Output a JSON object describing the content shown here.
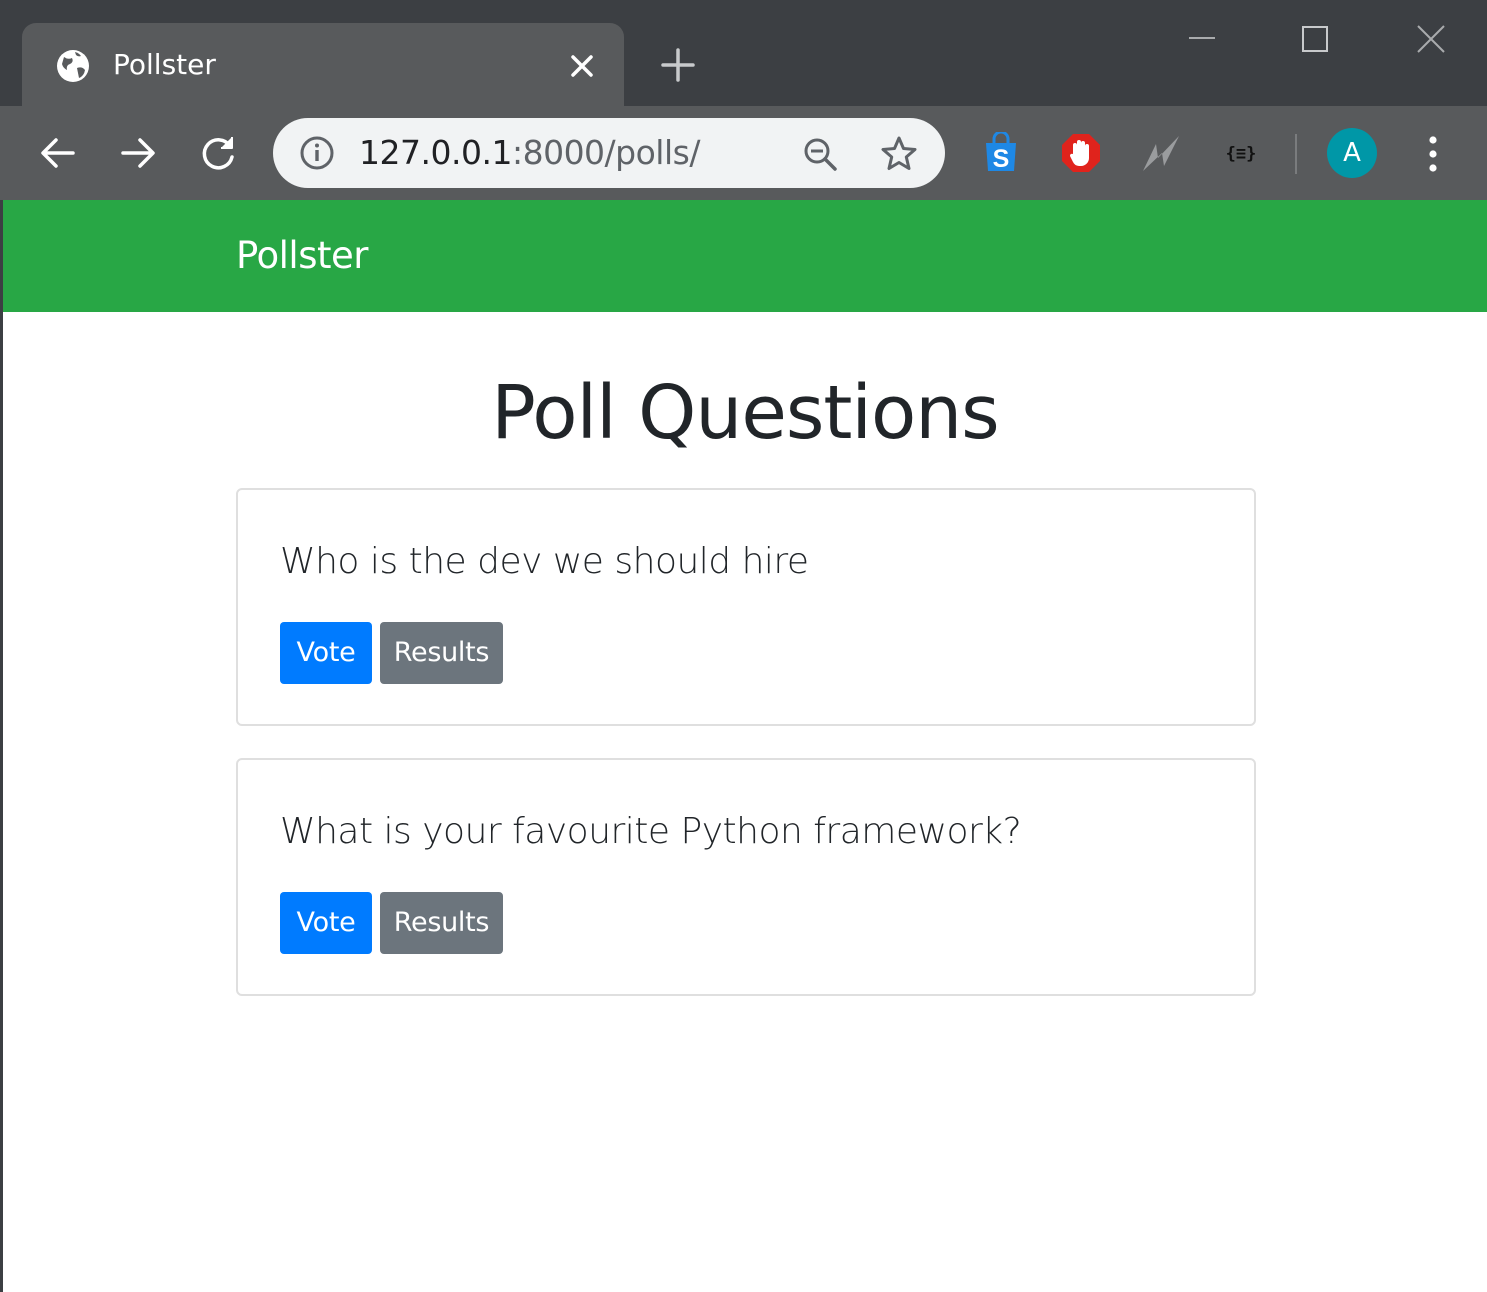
{
  "browser": {
    "tab": {
      "title": "Pollster",
      "favicon": "globe-icon"
    },
    "url": {
      "host": "127.0.0.1",
      "rest": ":8000/polls/"
    },
    "avatar_letter": "A",
    "extensions": [
      "shopping-s-icon",
      "adblock-hand-icon",
      "lightning-icon",
      "json-formatter-icon"
    ],
    "colors": {
      "tab_strip": "#3c3f43",
      "toolbar": "#585a5c",
      "omnibox": "#f1f3f4",
      "avatar": "#0097a7"
    }
  },
  "navbar": {
    "brand": "Pollster",
    "color": "#28a745"
  },
  "main": {
    "title": "Poll Questions",
    "questions": [
      {
        "text": "Who is the dev we should hire",
        "vote_label": "Vote",
        "results_label": "Results"
      },
      {
        "text": "What is your favourite Python framework?",
        "vote_label": "Vote",
        "results_label": "Results"
      }
    ],
    "colors": {
      "vote": "#007bff",
      "results": "#6c757d"
    }
  }
}
